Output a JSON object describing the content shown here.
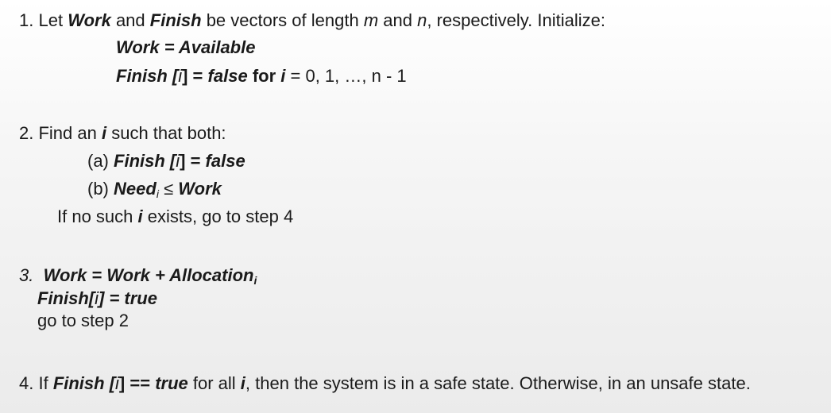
{
  "step1": {
    "number": "1.",
    "let": "Let",
    "work": "Work",
    "and": "and",
    "finish": "Finish",
    "be_vectors": "be vectors of length",
    "m": "m",
    "and2": "and",
    "n": "n",
    "respectively": ", respectively. Initialize:",
    "init_work": "Work = Available",
    "init_finish_a": "Finish [",
    "init_i": "i",
    "init_finish_b": "] =",
    "init_false": "false",
    "init_for": "for",
    "init_i2": "i",
    "init_rest": "= 0, 1, …, n - 1"
  },
  "step2": {
    "intro_a": "2. Find an",
    "intro_i": "i",
    "intro_b": "such that both:",
    "a_label": "(a)",
    "a_finish": "Finish [",
    "a_i": "i",
    "a_eq": "] =",
    "a_false": "false",
    "b_label": "(b)",
    "b_need": "Need",
    "b_sub": "i",
    "b_le": "≤",
    "b_work": "Work",
    "no_such_a": "If no such",
    "no_such_i": "i",
    "no_such_b": "exists, go to step 4"
  },
  "step3": {
    "number": "3.",
    "assign_a": "Work = Work + Allocation",
    "assign_sub": "i",
    "finish_a": "Finish[",
    "finish_i": "i",
    "finish_b": "] = true",
    "goto": "go to step 2"
  },
  "step4": {
    "intro": "4. If",
    "finish": "Finish [",
    "i": "i",
    "eq": "] ==",
    "true": "true",
    "forall": "for all",
    "i2": "i",
    "rest": ", then the system is in a safe state. Otherwise, in an unsafe state."
  }
}
